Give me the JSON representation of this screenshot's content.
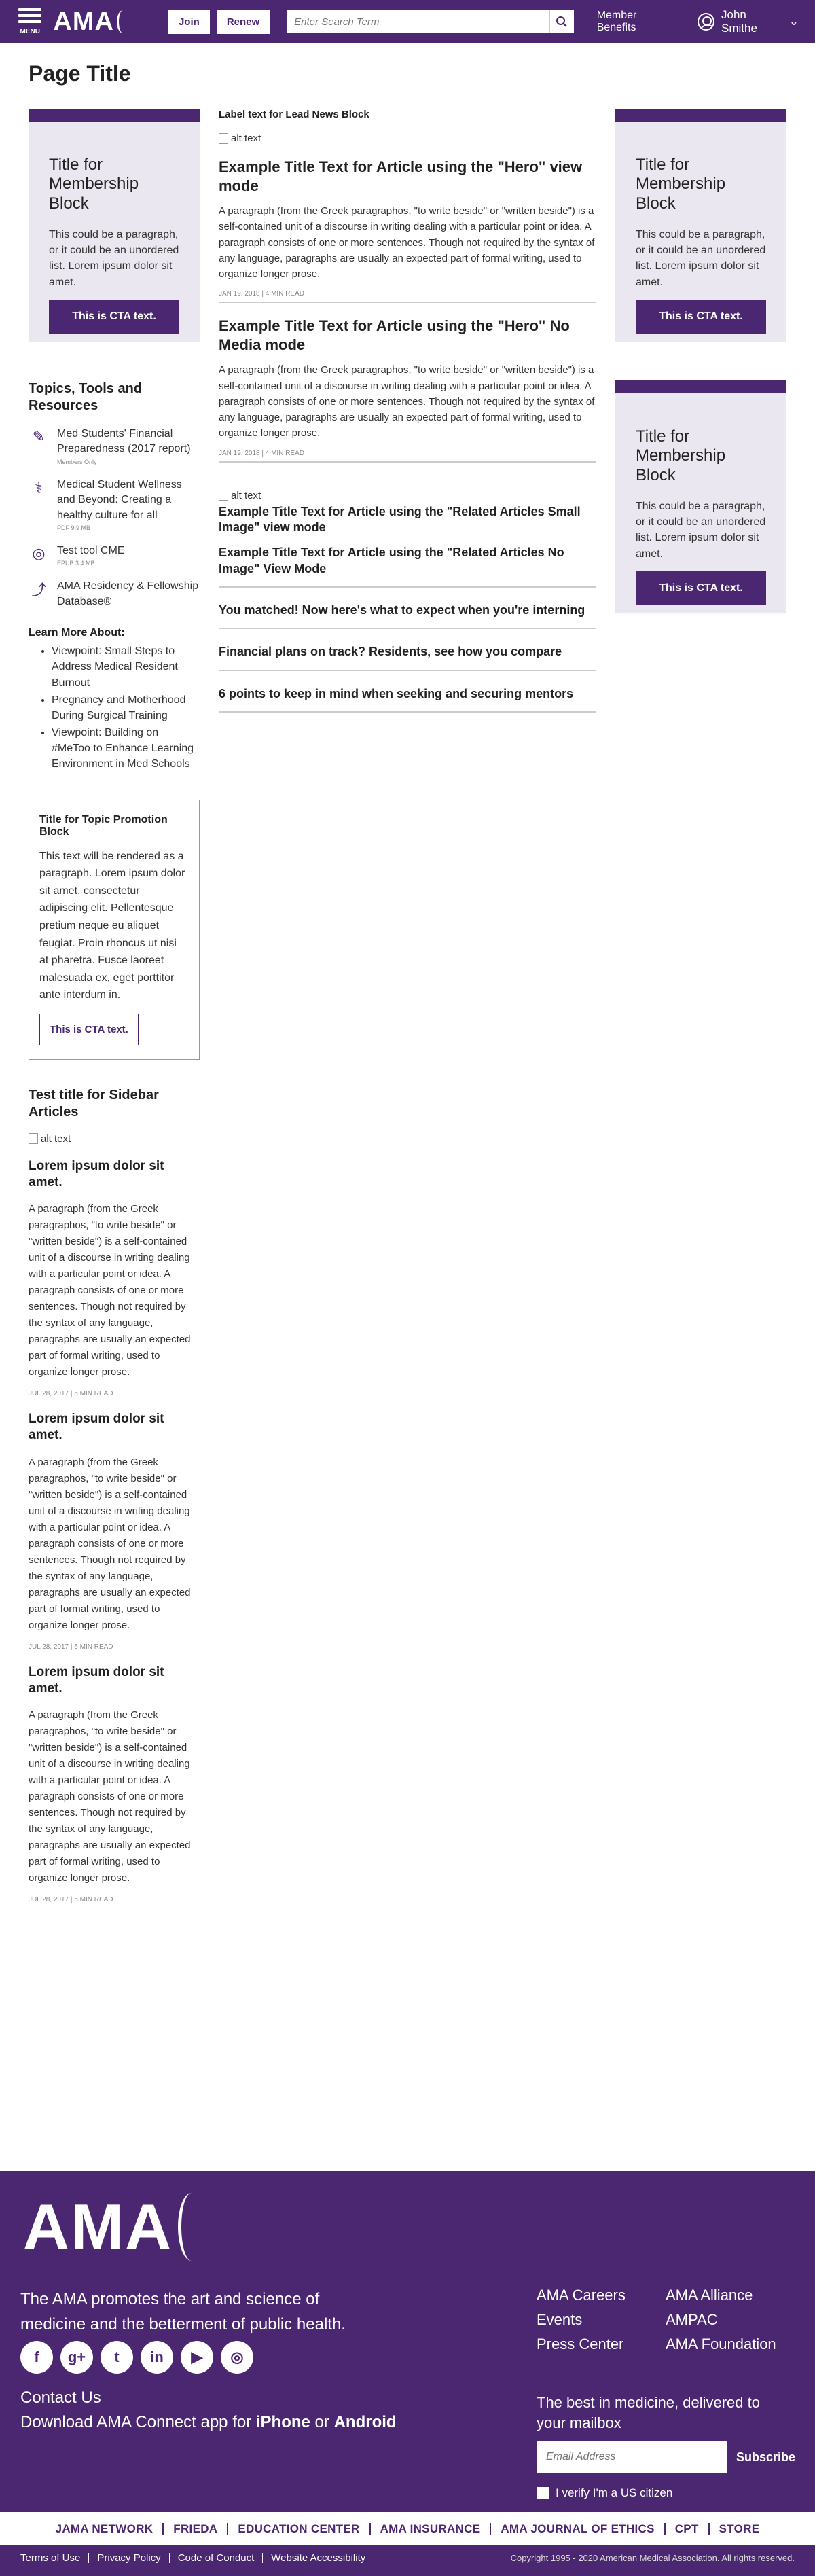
{
  "header": {
    "menu_label": "MENU",
    "logo": "AMA",
    "join": "Join",
    "renew": "Renew",
    "search_placeholder": "Enter Search Term",
    "member_benefits": "Member Benefits",
    "user_name": "John Smithe",
    "user_chevron": "⌄"
  },
  "page_title": "Page Title",
  "membership_block": {
    "title": "Title for Membership Block",
    "text": "This could be a paragraph, or it could be an unordered list. Lorem ipsum dolor sit amet.",
    "cta": "This is CTA text."
  },
  "left": {
    "topics_title": "Topics, Tools and Resources",
    "tools": [
      {
        "icon": "doc-icon",
        "glyph": "✎",
        "title": "Med Students' Financial Preparedness (2017 report)",
        "meta": "Members Only"
      },
      {
        "icon": "pdf-icon",
        "glyph": "⚕",
        "title": "Medical Student Wellness and Beyond: Creating a healthy culture for all",
        "meta": "PDF        9.9 MB"
      },
      {
        "icon": "cme-icon",
        "glyph": "◎",
        "title": "Test tool CME",
        "meta": "EPUB       3.4 MB"
      },
      {
        "icon": "external-link-icon",
        "glyph": "⤴",
        "title": "AMA Residency & Fellowship Database®",
        "meta": ""
      }
    ],
    "learn_title": "Learn More About:",
    "learn_items": [
      "Viewpoint: Small Steps to Address Medical Resident Burnout",
      "Pregnancy and Motherhood During Surgical Training",
      "Viewpoint: Building on #MeToo to Enhance Learning Environment in Med Schools"
    ],
    "promo": {
      "title": "Title for Topic Promotion Block",
      "text": "This text will be rendered as a paragraph. Lorem ipsum dolor sit amet, consectetur adipiscing elit. Pellentesque pretium neque eu aliquet feugiat. Proin rhoncus ut nisi at pharetra. Fusce laoreet malesuada ex, eget porttitor ante interdum in.",
      "cta": "This is CTA text."
    },
    "sidebar_title": "Test title for Sidebar Articles",
    "alt_text": "alt text",
    "articles": [
      {
        "title": "Lorem ipsum dolor sit amet.",
        "text": "A paragraph (from the Greek paragraphos, \"to write beside\" or \"written beside\") is a self-contained unit of a discourse in writing dealing with a particular point or idea. A paragraph consists of one or more sentences. Though not required by the syntax of any language, paragraphs are usually an expected part of formal writing, used to organize longer prose.",
        "meta": "JUL 28, 2017 | 5 MIN READ"
      },
      {
        "title": "Lorem ipsum dolor sit amet.",
        "text": "A paragraph (from the Greek paragraphos, \"to write beside\" or \"written beside\") is a self-contained unit of a discourse in writing dealing with a particular point or idea. A paragraph consists of one or more sentences. Though not required by the syntax of any language, paragraphs are usually an expected part of formal writing, used to organize longer prose.",
        "meta": "JUL 28, 2017 | 5 MIN READ"
      },
      {
        "title": "Lorem ipsum dolor sit amet.",
        "text": "A paragraph (from the Greek paragraphos, \"to write beside\" or \"written beside\") is a self-contained unit of a discourse in writing dealing with a particular point or idea. A paragraph consists of one or more sentences. Though not required by the syntax of any language, paragraphs are usually an expected part of formal writing, used to organize longer prose.",
        "meta": "JUL 28, 2017 | 5 MIN READ"
      }
    ]
  },
  "center": {
    "lead_label": "Label text for Lead News Block",
    "alt_text": "alt text",
    "hero1": {
      "title": "Example Title Text for Article using the \"Hero\" view mode",
      "text": "A paragraph (from the Greek paragraphos, \"to write beside\" or \"written beside\") is a self-contained unit of a discourse in writing dealing with a particular point or idea. A paragraph consists of one or more sentences. Though not required by the syntax of any language, paragraphs are usually an expected part of formal writing, used to organize longer prose.",
      "meta": "JAN 19, 2018 | 4 MIN READ"
    },
    "hero2": {
      "title": "Example Title Text for Article using the \"Hero\" No Media mode",
      "text": "A paragraph (from the Greek paragraphos, \"to write beside\" or \"written beside\") is a self-contained unit of a discourse in writing dealing with a particular point or idea. A paragraph consists of one or more sentences. Though not required by the syntax of any language, paragraphs are usually an expected part of formal writing, used to organize longer prose.",
      "meta": "JAN 19, 2018 | 4 MIN READ"
    },
    "related": [
      "Example Title Text for Article using the \"Related Articles Small Image\" view mode",
      "Example Title Text for Article using the \"Related Articles No Image\" View Mode",
      "You matched! Now here's what to expect when you're interning",
      "Financial plans on track? Residents, see how you compare",
      "6 points to keep in mind when seeking and securing mentors"
    ]
  },
  "footer": {
    "logo": "AMA",
    "mission": "The AMA promotes the art and science of medicine and the betterment of public health.",
    "social": [
      {
        "icon": "facebook-icon",
        "glyph": "f"
      },
      {
        "icon": "google-plus-icon",
        "glyph": "g+"
      },
      {
        "icon": "twitter-icon",
        "glyph": "t"
      },
      {
        "icon": "linkedin-icon",
        "glyph": "in"
      },
      {
        "icon": "youtube-icon",
        "glyph": "▶"
      },
      {
        "icon": "instagram-icon",
        "glyph": "◎"
      }
    ],
    "contact": "Contact Us",
    "app_prefix": "Download AMA Connect app for ",
    "app_iphone": "iPhone",
    "app_or": " or ",
    "app_android": "Android",
    "links": [
      "AMA Careers",
      "AMA Alliance",
      "Events",
      "AMPAC",
      "Press Center",
      "AMA Foundation"
    ],
    "best": "The best in medicine, delivered to your mailbox",
    "email_placeholder": "Email Address",
    "subscribe": "Subscribe",
    "verify": "I verify I'm a US citizen",
    "bar": [
      "JAMA NETWORK",
      "FRIEDA",
      "EDUCATION CENTER",
      "AMA INSURANCE",
      "AMA JOURNAL OF ETHICS",
      "CPT",
      "STORE"
    ],
    "bottom": [
      "Terms of Use",
      "Privacy Policy",
      "Code of Conduct",
      "Website Accessibility"
    ],
    "copyright": "Copyright 1995 - 2020 American Medical Association. All rights reserved."
  },
  "colors": {
    "brand": "#4b2771",
    "light": "#ebe7f0"
  }
}
